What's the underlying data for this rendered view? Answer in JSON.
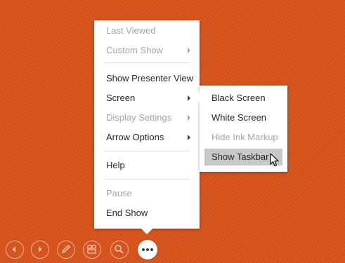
{
  "main_menu": {
    "last_viewed": "Last Viewed",
    "custom_show": "Custom Show",
    "show_presenter_view": "Show Presenter View",
    "screen": "Screen",
    "display_settings": "Display Settings",
    "arrow_options": "Arrow Options",
    "help": "Help",
    "pause": "Pause",
    "end_show": "End Show"
  },
  "screen_submenu": {
    "black_screen": "Black Screen",
    "white_screen": "White Screen",
    "hide_ink_markup": "Hide Ink Markup",
    "show_taskbar": "Show Taskbar"
  },
  "toolbar": {
    "icons": [
      "previous-icon",
      "next-icon",
      "pen-icon",
      "see-all-slides-icon",
      "zoom-icon",
      "more-options-icon"
    ]
  },
  "colors": {
    "background": "#d9531a",
    "menu_background": "#ffffff",
    "highlight": "#c8c8c8",
    "disabled_text": "#a6a6a6"
  }
}
